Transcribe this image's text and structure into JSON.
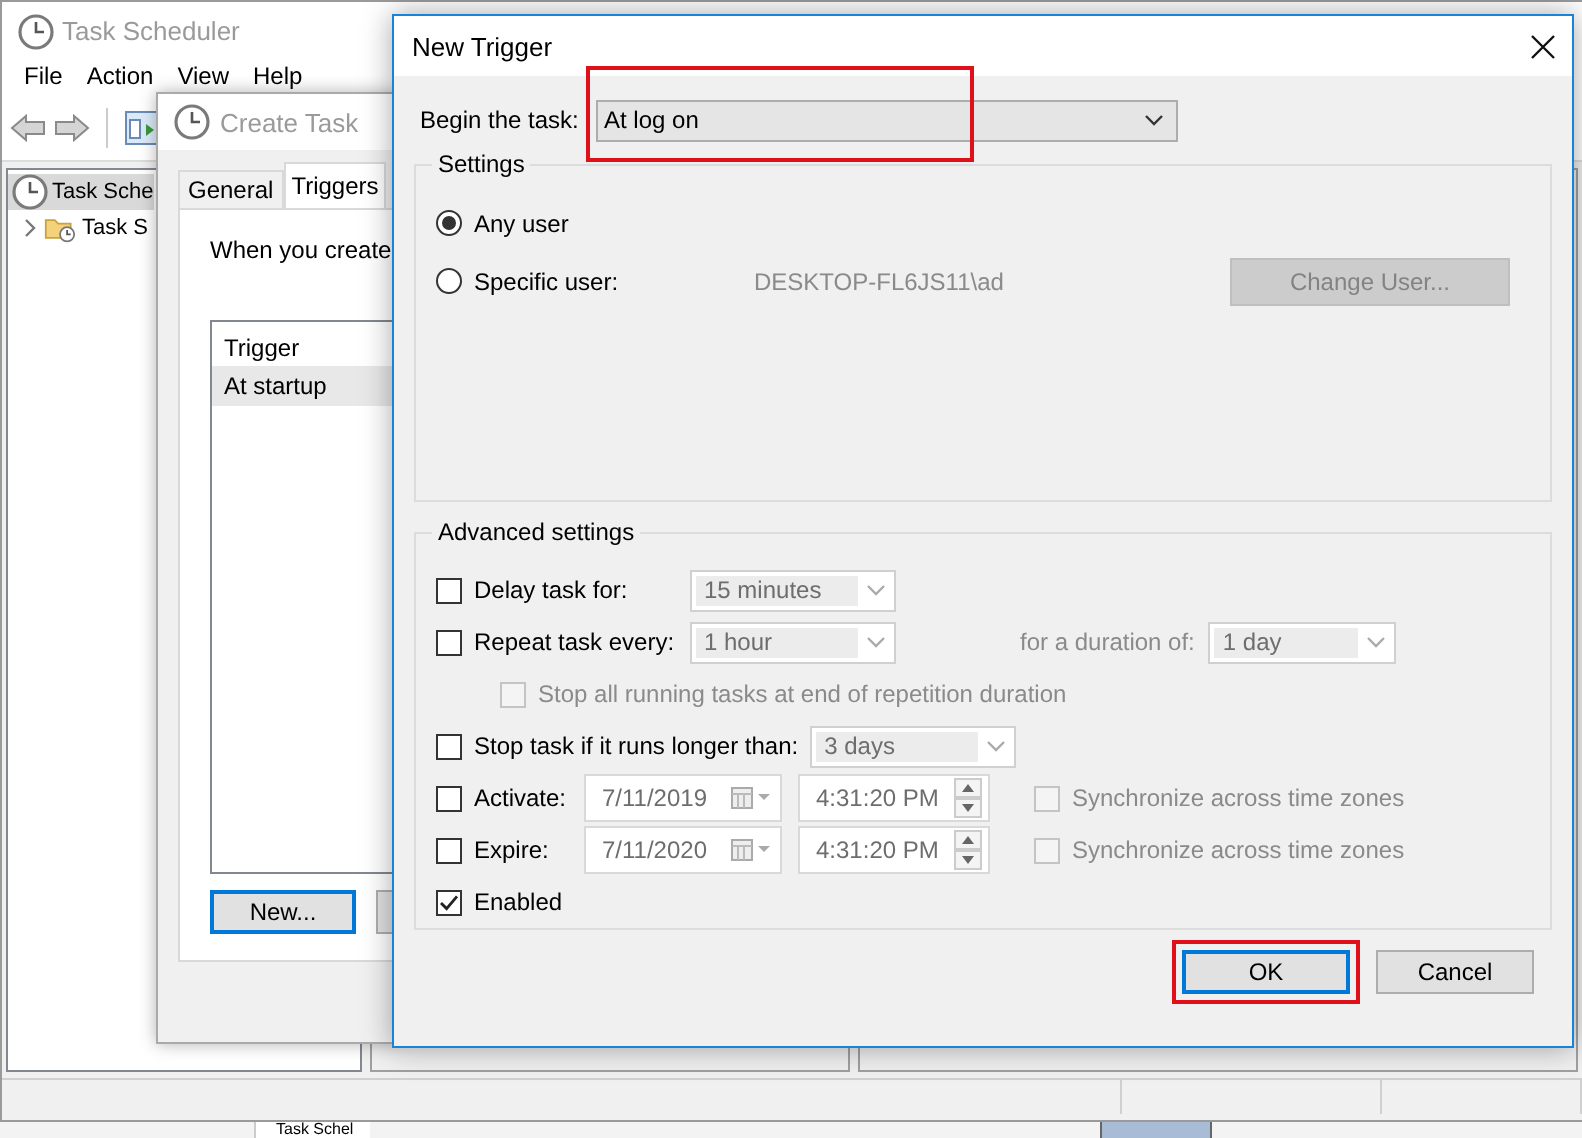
{
  "main_window": {
    "title": "Task Scheduler",
    "menu": [
      "File",
      "Action",
      "View",
      "Help"
    ],
    "tree": [
      {
        "label": "Task Sche",
        "selected": true,
        "children": [
          {
            "label": "Task S",
            "selected": false,
            "expanded": false
          }
        ]
      }
    ]
  },
  "create_task": {
    "title": "Create Task",
    "tabs": [
      {
        "label": "General",
        "selected": false
      },
      {
        "label": "Triggers",
        "selected": true
      }
    ],
    "intro": "When you create",
    "list": {
      "columns": [
        "Trigger"
      ],
      "rows": [
        {
          "cells": [
            "At startup"
          ],
          "selected": true
        }
      ]
    },
    "buttons": [
      {
        "label": "New...",
        "default": true
      }
    ]
  },
  "new_trigger": {
    "title": "New Trigger",
    "begin": {
      "label": "Begin the task:",
      "value": "At log on",
      "highlighted": true
    },
    "settings": {
      "title": "Settings",
      "options": [
        {
          "label": "Any user",
          "selected": true
        },
        {
          "label": "Specific user:",
          "selected": false
        }
      ],
      "user": "DESKTOP-FL6JS11\\ad",
      "change_user": {
        "label": "Change User...",
        "disabled": true
      }
    },
    "advanced": {
      "title": "Advanced settings",
      "rows": [
        {
          "kind": "select",
          "label": "Delay task for:",
          "checked": false,
          "value": "15 minutes"
        },
        {
          "kind": "repeat",
          "label": "Repeat task every:",
          "checked": false,
          "value": "1 hour",
          "duration_label": "for a duration of:",
          "duration_value": "1 day"
        },
        {
          "kind": "sub",
          "label": "Stop all running tasks at end of repetition duration",
          "checked": false,
          "disabled": true
        },
        {
          "kind": "select",
          "label": "Stop task if it runs longer than:",
          "checked": false,
          "value": "3 days"
        },
        {
          "kind": "datetime",
          "label": "Activate:",
          "checked": false,
          "date": "7/11/2019",
          "time": "4:31:20 PM",
          "sync_label": "Synchronize across time zones",
          "sync_checked": false
        },
        {
          "kind": "datetime",
          "label": "Expire:",
          "checked": false,
          "date": "7/11/2020",
          "time": "4:31:20 PM",
          "sync_label": "Synchronize across time zones",
          "sync_checked": false
        },
        {
          "kind": "check",
          "label": "Enabled",
          "checked": true
        }
      ]
    },
    "buttons": [
      {
        "label": "OK",
        "default": true,
        "highlighted": true
      },
      {
        "label": "Cancel",
        "default": false,
        "highlighted": false
      }
    ]
  },
  "background_window": {
    "item": "Task Schel"
  }
}
